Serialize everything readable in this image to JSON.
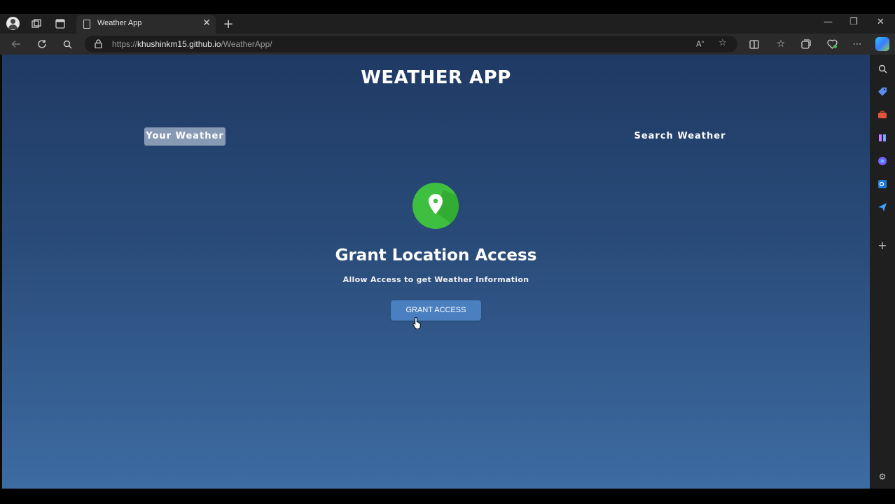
{
  "browser": {
    "tab_title": "Weather App",
    "tab_close": "✕",
    "new_tab": "+",
    "url_prefix": "https://",
    "url_host": "khushinkm15.github.io",
    "url_path": "/WeatherApp/",
    "window_controls": {
      "minimize": "—",
      "restore": "❐",
      "close": "✕"
    }
  },
  "app": {
    "title": "WEATHER APP",
    "tabs": {
      "your_weather": "Your Weather",
      "search_weather": "Search Weather"
    },
    "grant": {
      "heading": "Grant Location Access",
      "subtext": "Allow Access to get Weather Information",
      "button": "GRANT ACCESS"
    }
  },
  "colors": {
    "accent_green": "#3fbf3f",
    "button_blue": "#4a7fc0",
    "bg_top": "#1f3a64",
    "bg_bottom": "#3d6ca3"
  }
}
